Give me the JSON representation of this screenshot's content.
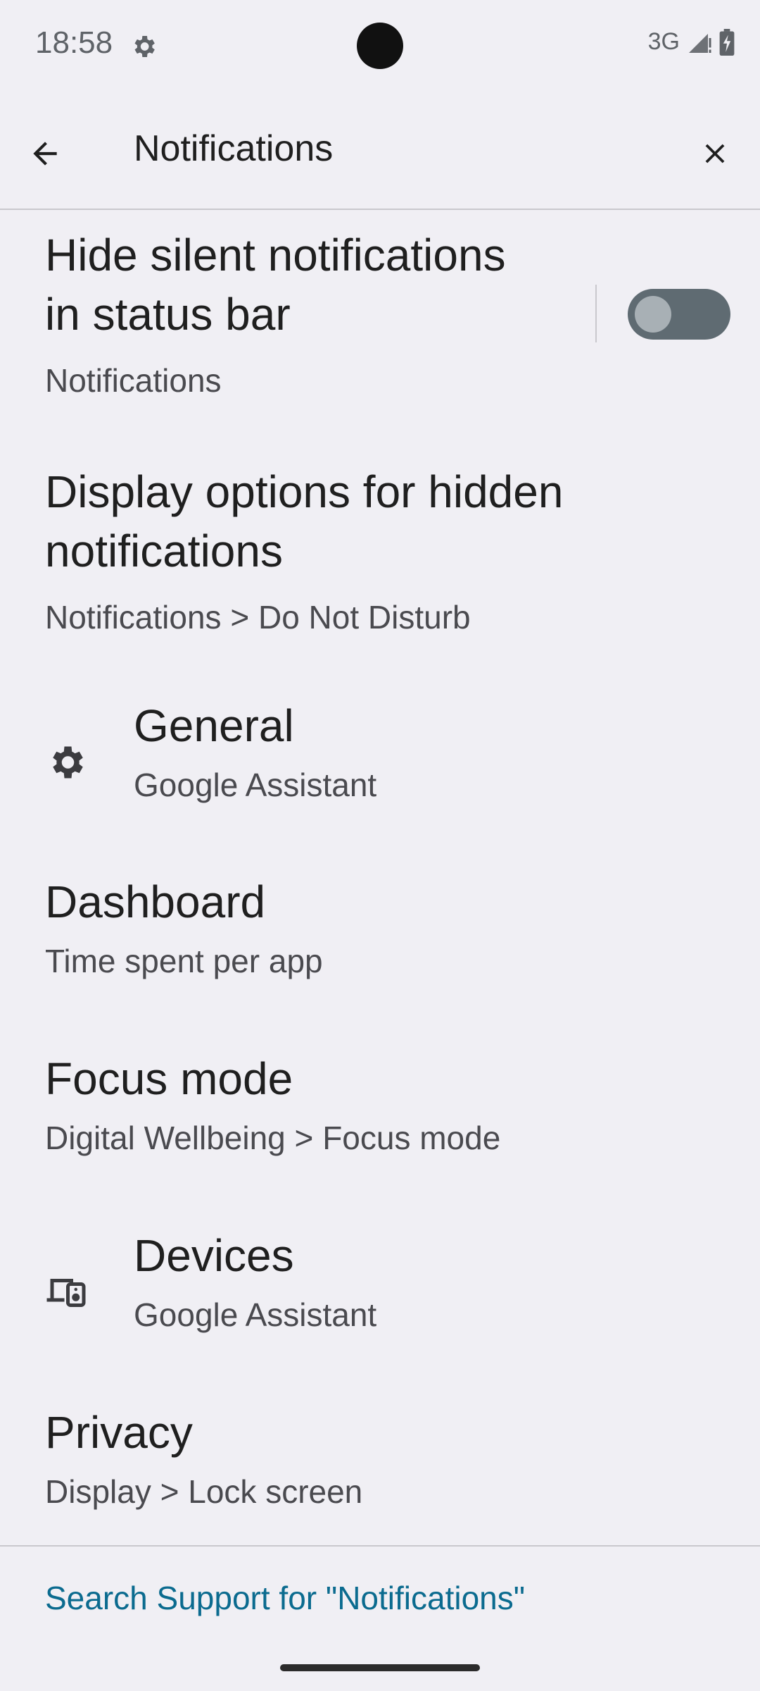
{
  "status": {
    "time": "18:58",
    "network": "3G"
  },
  "toolbar": {
    "title": "Notifications"
  },
  "results": [
    {
      "title_line1": "Hide silent notifications",
      "title_line2": "in status bar",
      "subtitle": "Notifications",
      "toggle_on": false
    },
    {
      "title_line1": "Display options for hidden",
      "title_line2": "notifications",
      "subtitle": "Notifications > Do Not Disturb"
    },
    {
      "title": "General",
      "subtitle": "Google Assistant",
      "icon": "gear-icon"
    },
    {
      "title": "Dashboard",
      "subtitle": "Time spent per app"
    },
    {
      "title": "Focus mode",
      "subtitle": "Digital Wellbeing > Focus mode"
    },
    {
      "title": "Devices",
      "subtitle": "Google Assistant",
      "icon": "devices-icon"
    },
    {
      "title": "Privacy",
      "subtitle": "Display > Lock screen"
    }
  ],
  "footer": {
    "support_link": "Search Support for \"Notifications\""
  },
  "colors": {
    "background": "#f0eff4",
    "link": "#0b6b8f",
    "toggle_track": "#5f6b72"
  }
}
